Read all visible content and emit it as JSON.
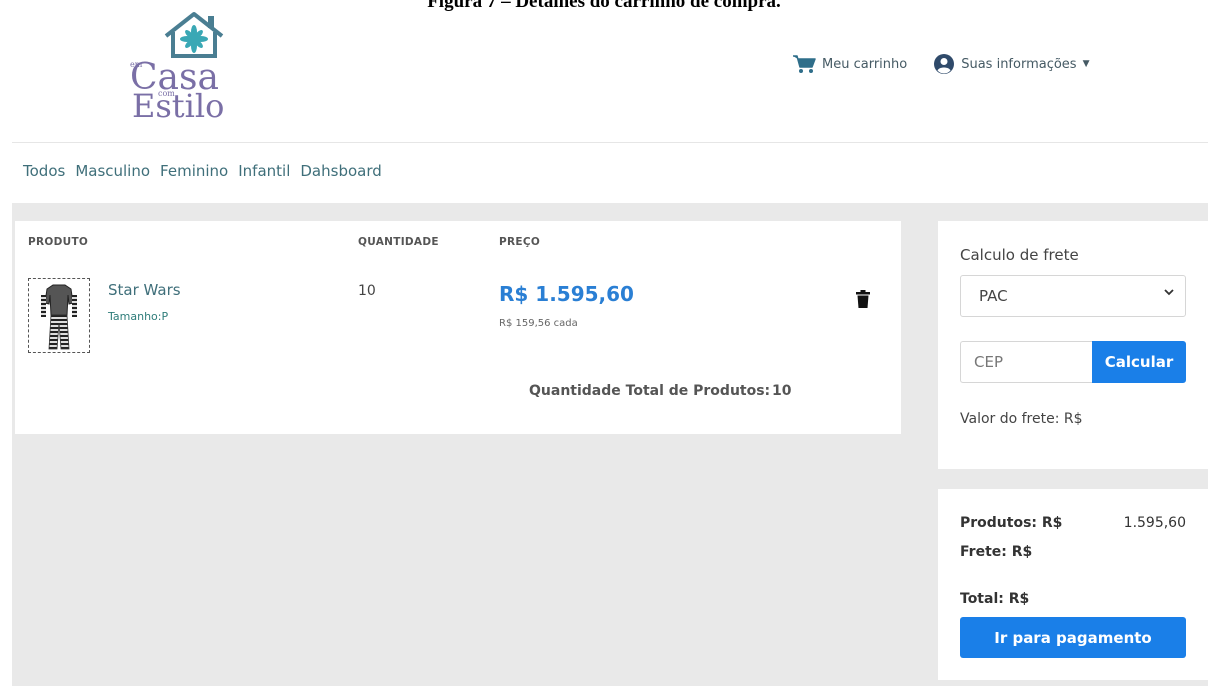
{
  "caption": "Figura 7 – Detalhes do carrinho de compra.",
  "brand": {
    "small_top": "em",
    "line1": "Casa",
    "small_mid": "com",
    "line2": "Estilo"
  },
  "header": {
    "cart_label": "Meu carrinho",
    "account_label": "Suas informações"
  },
  "nav": {
    "items": [
      "Todos",
      "Masculino",
      "Feminino",
      "Infantil",
      "Dahsboard"
    ]
  },
  "cart": {
    "headers": {
      "product": "PRODUTO",
      "quantity": "QUANTIDADE",
      "price": "PREÇO"
    },
    "item": {
      "name": "Star Wars",
      "size": "Tamanho:P",
      "quantity": "10",
      "price": "R$ 1.595,60",
      "unit_price": "R$ 159,56 cada"
    },
    "total_quantity_label": "Quantidade Total de Produtos:",
    "total_quantity_value": "10"
  },
  "freight": {
    "title": "Calculo de frete",
    "method": "PAC",
    "cep_placeholder": "CEP",
    "calc_label": "Calcular",
    "value_label": "Valor do frete: R$"
  },
  "summary": {
    "products_label": "Produtos: R$",
    "products_value": "1.595,60",
    "freight_label": "Frete: R$",
    "total_label": "Total: R$",
    "pay_label": "Ir para pagamento"
  },
  "colors": {
    "accent": "#1a7fe8",
    "teal": "#3f6f7a",
    "brand": "#7a6fa6",
    "background": "#e9e9e9"
  }
}
